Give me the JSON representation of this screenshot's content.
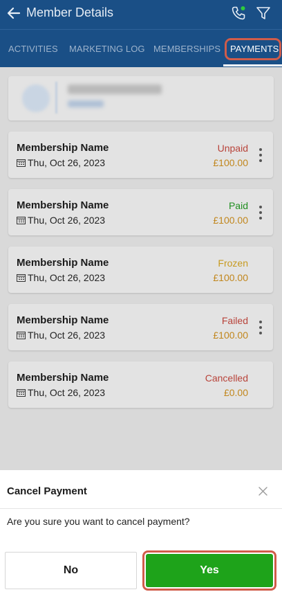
{
  "header": {
    "title": "Member Details",
    "back_icon": "arrow-left-icon",
    "call_icon": "phone-icon",
    "filter_icon": "filter-funnel-icon",
    "color": "#1a4f86"
  },
  "tabs": [
    {
      "label": "ACTIVITIES",
      "active": false
    },
    {
      "label": "MARKETING LOG",
      "active": false
    },
    {
      "label": "MEMBERSHIPS",
      "active": false
    },
    {
      "label": "PAYMENTS",
      "active": true
    }
  ],
  "member": {
    "name": "",
    "subtitle": "",
    "note": "member name and role are blurred in the screenshot"
  },
  "payments": [
    {
      "name": "Membership Name",
      "date": "Thu, Oct 26, 2023",
      "status": "Unpaid",
      "amount": "£100.00",
      "status_color": "#b8433a",
      "has_menu": true
    },
    {
      "name": "Membership Name",
      "date": "Thu, Oct 26, 2023",
      "status": "Paid",
      "amount": "£100.00",
      "status_color": "#1f8e1f",
      "has_menu": true
    },
    {
      "name": "Membership Name",
      "date": "Thu, Oct 26, 2023",
      "status": "Frozen",
      "amount": "£100.00",
      "status_color": "#c79a1e",
      "has_menu": false
    },
    {
      "name": "Membership Name",
      "date": "Thu, Oct 26, 2023",
      "status": "Failed",
      "amount": "£100.00",
      "status_color": "#b8433a",
      "has_menu": true
    },
    {
      "name": "Membership Name",
      "date": "Thu, Oct 26, 2023",
      "status": "Cancelled",
      "amount": "£0.00",
      "status_color": "#b8433a",
      "has_menu": false
    }
  ],
  "dialog": {
    "title": "Cancel Payment",
    "message": "Are you sure you want to cancel payment?",
    "no_label": "No",
    "yes_label": "Yes",
    "yes_color": "#1ea31a"
  }
}
